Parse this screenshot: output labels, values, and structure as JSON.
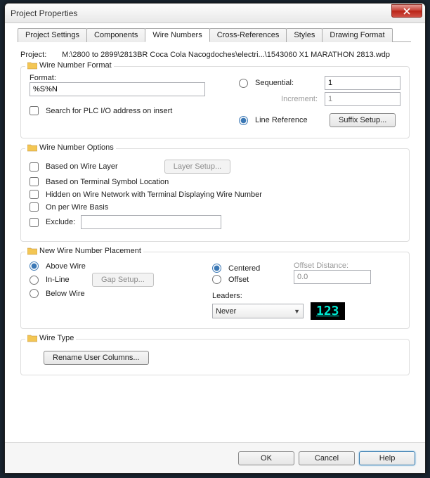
{
  "window_title": "Project Properties",
  "tabs": [
    "Project Settings",
    "Components",
    "Wire Numbers",
    "Cross-References",
    "Styles",
    "Drawing Format"
  ],
  "active_tab": 2,
  "project_label": "Project:",
  "project_path": "M:\\2800 to 2899\\2813BR Coca Cola Nacogdoches\\electri...\\1543060 X1 MARATHON 2813.wdp",
  "format_group": {
    "title": "Wire Number Format",
    "format_label": "Format:",
    "format_value": "%S%N",
    "search_plc": "Search for PLC I/O address on insert",
    "sequential": "Sequential:",
    "sequential_value": "1",
    "increment": "Increment:",
    "increment_value": "1",
    "line_reference": "Line Reference",
    "suffix_setup": "Suffix Setup...",
    "mode_selected": "line_reference"
  },
  "options_group": {
    "title": "Wire Number Options",
    "based_layer": "Based on Wire Layer",
    "layer_setup": "Layer Setup...",
    "based_terminal": "Based on Terminal Symbol Location",
    "hidden_network": "Hidden on Wire Network with Terminal Displaying Wire Number",
    "per_wire": "On per Wire Basis",
    "exclude": "Exclude:",
    "exclude_value": ""
  },
  "placement_group": {
    "title": "New Wire Number Placement",
    "above": "Above Wire",
    "inline": "In-Line",
    "below": "Below Wire",
    "gap_setup": "Gap Setup...",
    "position_selected": "above",
    "centered": "Centered",
    "offset": "Offset",
    "align_selected": "centered",
    "offset_distance_label": "Offset Distance:",
    "offset_distance_value": "0.0",
    "leaders_label": "Leaders:",
    "leaders_value": "Never",
    "preview": "123"
  },
  "wiretype_group": {
    "title": "Wire Type",
    "rename": "Rename User Columns..."
  },
  "footer": {
    "ok": "OK",
    "cancel": "Cancel",
    "help": "Help"
  }
}
